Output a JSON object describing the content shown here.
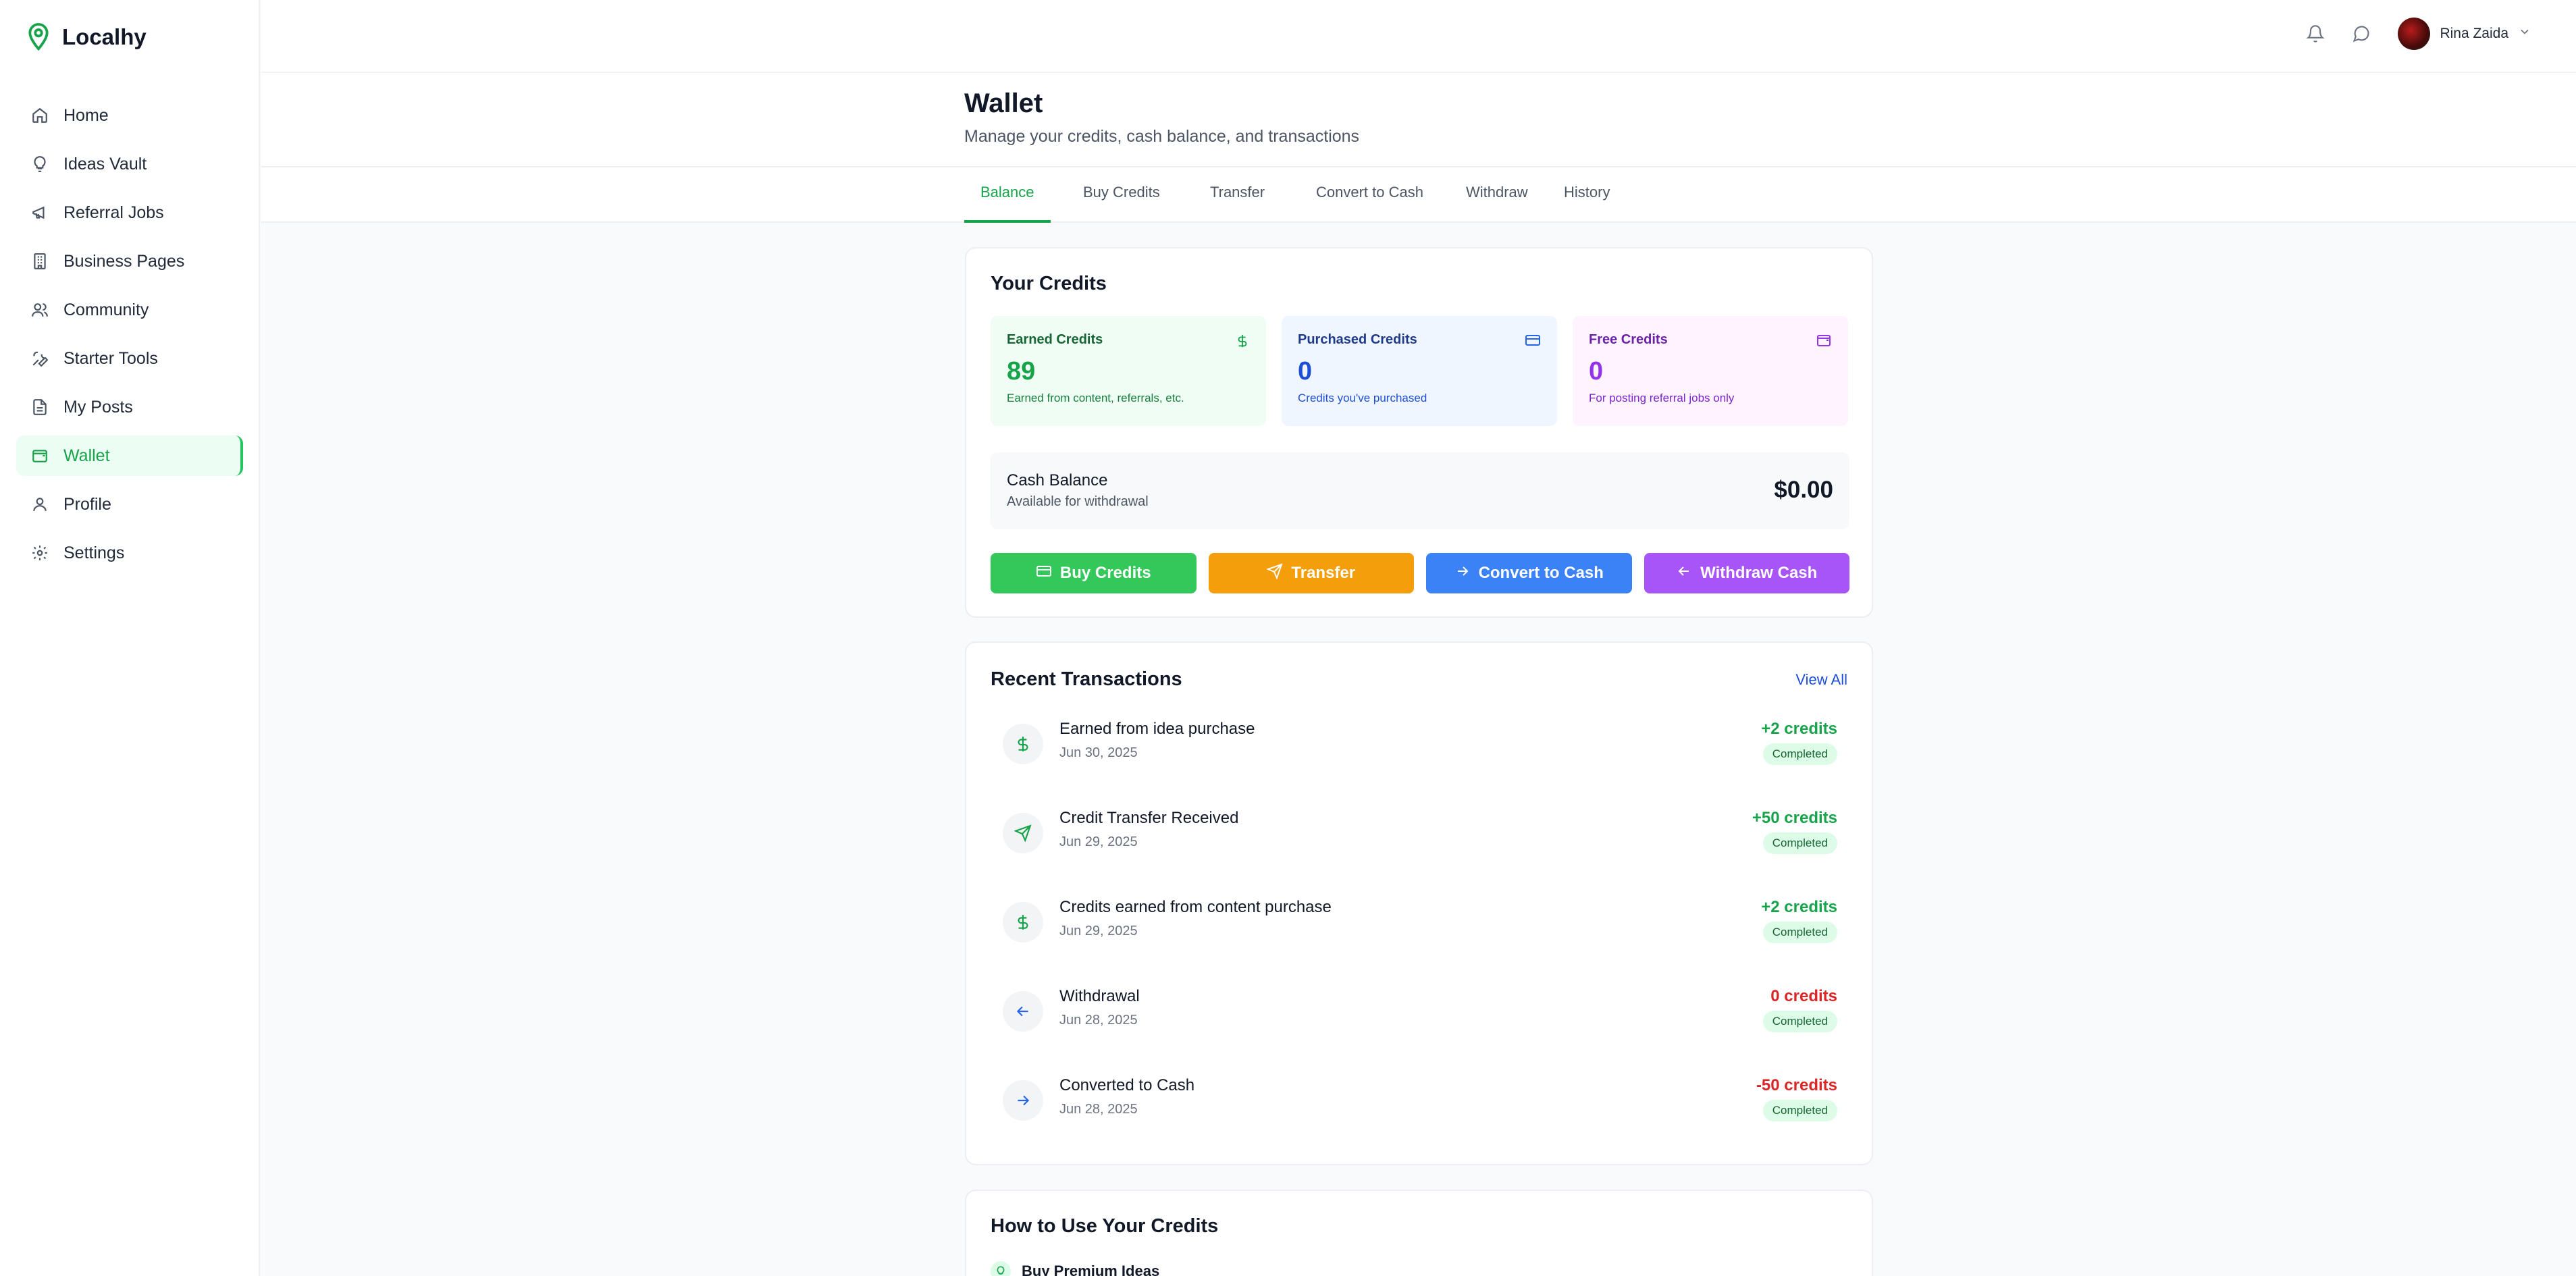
{
  "app": {
    "name": "Localhy"
  },
  "sidebar": {
    "items": [
      {
        "label": "Home",
        "icon": "home-icon"
      },
      {
        "label": "Ideas Vault",
        "icon": "lightbulb-icon"
      },
      {
        "label": "Referral Jobs",
        "icon": "megaphone-icon"
      },
      {
        "label": "Business Pages",
        "icon": "building-icon"
      },
      {
        "label": "Community",
        "icon": "users-icon"
      },
      {
        "label": "Starter Tools",
        "icon": "wrench-icon"
      },
      {
        "label": "My Posts",
        "icon": "document-icon"
      },
      {
        "label": "Wallet",
        "icon": "wallet-icon",
        "active": true
      },
      {
        "label": "Profile",
        "icon": "user-icon"
      },
      {
        "label": "Settings",
        "icon": "gear-icon"
      }
    ]
  },
  "topbar": {
    "user_name": "Rina Zaida"
  },
  "page": {
    "title": "Wallet",
    "subtitle": "Manage your credits, cash balance, and transactions"
  },
  "tabs": [
    "Balance",
    "Buy Credits",
    "Transfer",
    "Convert to Cash",
    "Withdraw",
    "History"
  ],
  "credits": {
    "title": "Your Credits",
    "earned": {
      "label": "Earned Credits",
      "value": "89",
      "sub": "Earned from content, referrals, etc.",
      "color": "#16a34a",
      "bg": "#f0fdf4"
    },
    "purchased": {
      "label": "Purchased Credits",
      "value": "0",
      "sub": "Credits you've purchased",
      "color": "#1d4ed8",
      "bg": "#eff6ff"
    },
    "free": {
      "label": "Free Credits",
      "value": "0",
      "sub": "For posting referral jobs only",
      "color": "#7e22ce",
      "bg": "#fdf4ff"
    }
  },
  "cash": {
    "title": "Cash Balance",
    "subtitle": "Available for withdrawal",
    "value": "$0.00"
  },
  "actions": [
    {
      "label": "Buy Credits",
      "color": "#34c759"
    },
    {
      "label": "Transfer",
      "color": "#f59e0b"
    },
    {
      "label": "Convert to Cash",
      "color": "#3b82f6"
    },
    {
      "label": "Withdraw Cash",
      "color": "#a855f7"
    }
  ],
  "transactions": {
    "title": "Recent Transactions",
    "view_all": "View All",
    "items": [
      {
        "title": "Earned from idea purchase",
        "date": "Jun 30, 2025",
        "amount": "+2 credits",
        "status": "Completed",
        "icon": "dollar-icon",
        "positive": true
      },
      {
        "title": "Credit Transfer Received",
        "date": "Jun 29, 2025",
        "amount": "+50 credits",
        "status": "Completed",
        "icon": "send-icon",
        "positive": true
      },
      {
        "title": "Credits earned from content purchase",
        "date": "Jun 29, 2025",
        "amount": "+2 credits",
        "status": "Completed",
        "icon": "dollar-icon",
        "positive": true
      },
      {
        "title": "Withdrawal",
        "date": "Jun 28, 2025",
        "amount": "0 credits",
        "status": "Completed",
        "icon": "arrow-left-icon",
        "positive": false
      },
      {
        "title": "Converted to Cash",
        "date": "Jun 28, 2025",
        "amount": "-50 credits",
        "status": "Completed",
        "icon": "arrow-right-icon",
        "positive": false
      }
    ]
  },
  "howto": {
    "title": "How to Use Your Credits",
    "first_item": "Buy Premium Ideas"
  }
}
